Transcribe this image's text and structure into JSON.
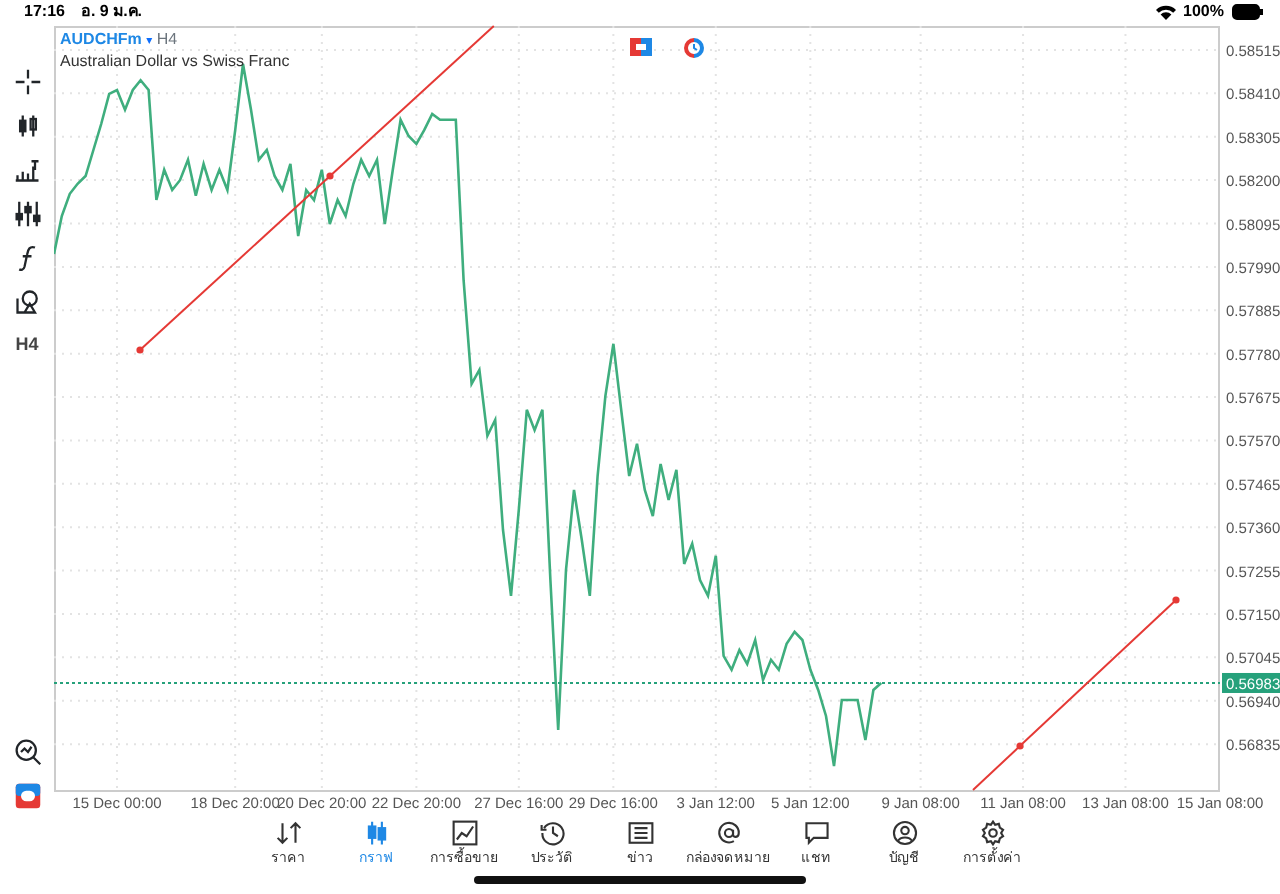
{
  "status_bar": {
    "time": "17:16",
    "date": "อ. 9 ม.ค.",
    "battery": "100%"
  },
  "symbol": {
    "name": "AUDCHFm",
    "caret": "▾",
    "timeframe": "H4",
    "description": "Australian Dollar vs Swiss Franc"
  },
  "left_toolbar": {
    "timeframe": "H4"
  },
  "chart_data": {
    "type": "line",
    "grid": true,
    "ylim": [
      0.56724,
      0.58573
    ],
    "categories": [
      null,
      null,
      null,
      null,
      null,
      null,
      null,
      null,
      "15 Dec 00:00",
      null,
      null,
      null,
      null,
      null,
      null,
      null,
      null,
      null,
      null,
      null,
      null,
      null,
      null,
      "18 Dec 20:00",
      null,
      null,
      null,
      null,
      null,
      null,
      null,
      null,
      null,
      null,
      "20 Dec 20:00",
      null,
      null,
      null,
      null,
      null,
      null,
      null,
      null,
      null,
      null,
      null,
      "22 Dec 20:00",
      null,
      null,
      null,
      null,
      null,
      null,
      null,
      null,
      null,
      null,
      null,
      null,
      "27 Dec 16:00",
      null,
      null,
      null,
      null,
      null,
      null,
      null,
      null,
      null,
      null,
      null,
      "29 Dec 16:00",
      null,
      null,
      null,
      null,
      null,
      null,
      null,
      null,
      null,
      null,
      null,
      null,
      "3 Jan 12:00",
      null,
      null,
      null,
      null,
      null,
      null,
      null,
      null,
      null,
      null,
      null,
      "5 Jan 12:00",
      null,
      null,
      null,
      null,
      null,
      null,
      null,
      null,
      null,
      null,
      null,
      null,
      null,
      "9 Jan 08:00",
      null,
      null,
      null,
      null,
      null,
      null,
      null,
      null,
      null,
      null,
      null,
      null,
      "11 Jan 08:00",
      null,
      null,
      null,
      null,
      null,
      null,
      null,
      null,
      null,
      null,
      null,
      null,
      "13 Jan 08:00",
      null,
      null,
      null,
      null,
      null,
      null,
      null,
      null,
      null,
      null,
      null,
      "15 Jan 08:00"
    ],
    "yticks": [
      {
        "value": 0.58515,
        "label": "0.58515"
      },
      {
        "value": 0.5841,
        "label": "0.58410"
      },
      {
        "value": 0.58305,
        "label": "0.58305"
      },
      {
        "value": 0.582,
        "label": "0.58200"
      },
      {
        "value": 0.58095,
        "label": "0.58095"
      },
      {
        "value": 0.5799,
        "label": "0.57990"
      },
      {
        "value": 0.57885,
        "label": "0.57885"
      },
      {
        "value": 0.5778,
        "label": "0.57780"
      },
      {
        "value": 0.57675,
        "label": "0.57675"
      },
      {
        "value": 0.5757,
        "label": "0.57570"
      },
      {
        "value": 0.57465,
        "label": "0.57465"
      },
      {
        "value": 0.5736,
        "label": "0.57360"
      },
      {
        "value": 0.57255,
        "label": "0.57255"
      },
      {
        "value": 0.5715,
        "label": "0.57150"
      },
      {
        "value": 0.57045,
        "label": "0.57045"
      },
      {
        "value": 0.5694,
        "label": "0.56940"
      },
      {
        "value": 0.56835,
        "label": "0.56835"
      }
    ],
    "series": [
      {
        "color": "#3fae7e",
        "values": [
          0.58021,
          0.58113,
          0.58167,
          0.58191,
          0.5821,
          0.58273,
          0.58336,
          0.58409,
          0.58418,
          0.5837,
          0.58418,
          0.58442,
          0.58418,
          0.58152,
          0.58225,
          0.58176,
          0.582,
          0.58249,
          0.58162,
          0.58239,
          0.58176,
          0.58225,
          0.58176,
          0.58321,
          0.58481,
          0.5837,
          0.58249,
          0.58273,
          0.5821,
          0.58176,
          0.58239,
          0.58065,
          0.58176,
          0.58152,
          0.58225,
          0.58094,
          0.58152,
          0.58113,
          0.58191,
          0.58249,
          0.5821,
          0.58249,
          0.58094,
          0.58225,
          0.58346,
          0.58307,
          0.58288,
          0.58321,
          0.5836,
          0.58346,
          0.58346,
          0.58346,
          0.57958,
          0.57707,
          0.57741,
          0.57581,
          0.5762,
          0.57353,
          0.57194,
          0.57402,
          0.57644,
          0.57595,
          0.57644,
          0.57232,
          0.56869,
          0.57257,
          0.5745,
          0.57329,
          0.57194,
          0.57484,
          0.57678,
          0.57804,
          0.57644,
          0.57484,
          0.57562,
          0.5745,
          0.57387,
          0.57513,
          0.57426,
          0.57499,
          0.57271,
          0.5732,
          0.57232,
          0.57194,
          0.57291,
          0.57049,
          0.57015,
          0.57063,
          0.57029,
          0.57087,
          0.5699,
          0.57039,
          0.57015,
          0.57078,
          0.57107,
          0.57087,
          0.57015,
          0.56966,
          0.56903,
          0.56782,
          0.56942,
          0.56942,
          0.56942,
          0.56845,
          0.56966,
          0.56983,
          null,
          null,
          null,
          null,
          null,
          null,
          null,
          null,
          null,
          null,
          null,
          null,
          null,
          null,
          null,
          null,
          null,
          null,
          null,
          null,
          null,
          null,
          null,
          null,
          null,
          null,
          null,
          null,
          null,
          null,
          null,
          null,
          null,
          null,
          null,
          null,
          null,
          null,
          null,
          null,
          null,
          null,
          null
        ]
      }
    ],
    "ref_lines": [
      {
        "axis": "y",
        "value": 0.56983,
        "label": "0.56983"
      }
    ]
  },
  "tabs": [
    {
      "label": "ราคา",
      "selected": false
    },
    {
      "label": "กราฟ",
      "selected": true
    },
    {
      "label": "การซื้อขาย",
      "selected": false
    },
    {
      "label": "ประวัติ",
      "selected": false
    },
    {
      "label": "ข่าว",
      "selected": false
    },
    {
      "label": "กล่องจดหมาย",
      "selected": false
    },
    {
      "label": "แชท",
      "selected": false
    },
    {
      "label": "บัญชี",
      "selected": false
    },
    {
      "label": "การตั้งค่า",
      "selected": false
    }
  ]
}
